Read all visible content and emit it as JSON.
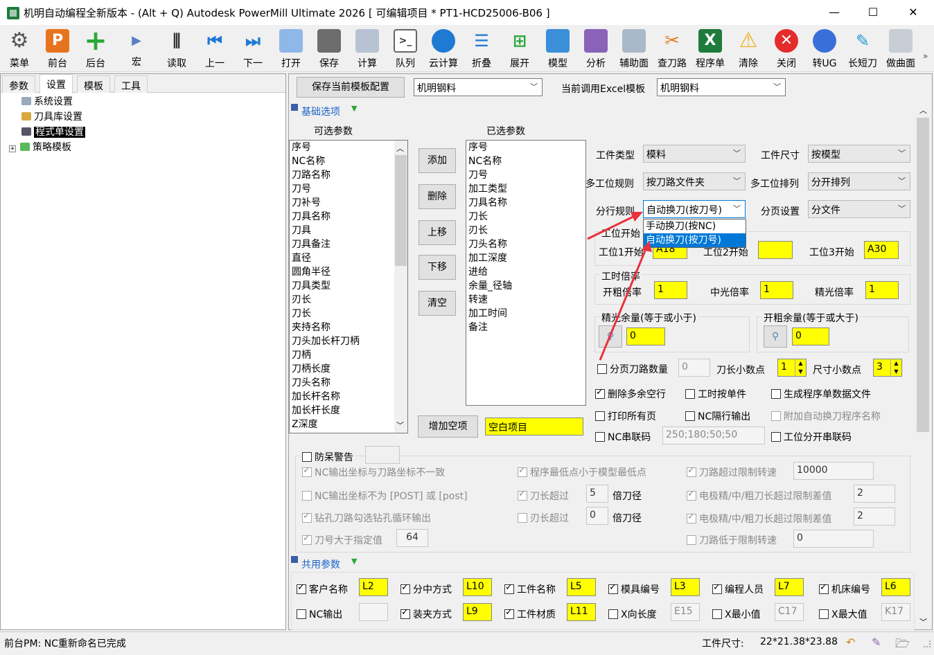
{
  "window": {
    "title": "机明自动编程全新版本 - (Alt + Q) Autodesk PowerMill Ultimate 2026    [ 可编辑项目 * PT1-HCD25006-B06 ]",
    "min": "—",
    "max": "☐",
    "close": "✕"
  },
  "toolbar": {
    "items": [
      {
        "label": "菜单",
        "icon": "gear-icon"
      },
      {
        "label": "前台",
        "icon": "powermill-icon"
      },
      {
        "label": "后台",
        "icon": "plus-icon"
      },
      {
        "label": "宏",
        "icon": "macro-icon"
      },
      {
        "label": "读取",
        "icon": "sliders-icon"
      },
      {
        "label": "上一",
        "icon": "prev-icon"
      },
      {
        "label": "下一",
        "icon": "next-icon"
      },
      {
        "label": "打开",
        "icon": "folder-icon"
      },
      {
        "label": "保存",
        "icon": "save-icon"
      },
      {
        "label": "计算",
        "icon": "calculator-icon"
      },
      {
        "label": "队列",
        "icon": "terminal-icon"
      },
      {
        "label": "云计算",
        "icon": "cloud-icon"
      },
      {
        "label": "折叠",
        "icon": "collapse-icon"
      },
      {
        "label": "展开",
        "icon": "expand-icon"
      },
      {
        "label": "模型",
        "icon": "cube-icon"
      },
      {
        "label": "分析",
        "icon": "analyze-icon"
      },
      {
        "label": "辅助面",
        "icon": "surface-icon"
      },
      {
        "label": "查刀路",
        "icon": "tools-icon"
      },
      {
        "label": "程序单",
        "icon": "excel-icon"
      },
      {
        "label": "清除",
        "icon": "warning-icon"
      },
      {
        "label": "关闭",
        "icon": "close-circle-icon"
      },
      {
        "label": "转UG",
        "icon": "ug-icon"
      },
      {
        "label": "长短刀",
        "icon": "tool-length-icon"
      },
      {
        "label": "做曲面",
        "icon": "make-surface-icon"
      }
    ],
    "overflow": "»"
  },
  "left": {
    "tabs": [
      "参数",
      "设置",
      "模板",
      "工具"
    ],
    "tree": [
      {
        "label": "系统设置"
      },
      {
        "label": "刀具库设置"
      },
      {
        "label": "程式单设置"
      },
      {
        "label": "策略模板"
      }
    ]
  },
  "top": {
    "save_button": "保存当前模板配置",
    "template_value": "机明钢料",
    "excel_label": "当前调用Excel模板",
    "excel_value": "机明钢料"
  },
  "basic": {
    "section_title": "基础选项",
    "available_title": "可选参数",
    "selected_title": "已选参数",
    "available": [
      "序号",
      "NC名称",
      "刀路名称",
      "刀号",
      "刀补号",
      "刀具名称",
      "刀具",
      "刀具备注",
      "直径",
      "圆角半径",
      "刀具类型",
      "刃长",
      "刀长",
      "夹持名称",
      "刀头加长杆刀柄",
      "刀柄",
      "刀柄长度",
      "刀头名称",
      "加长杆名称",
      "加长杆长度",
      "Z深度"
    ],
    "selected": [
      "序号",
      "NC名称",
      "刀号",
      "加工类型",
      "刀具名称",
      "刀长",
      "刃长",
      "刀头名称",
      "加工深度",
      "进给",
      "余量_径轴",
      "转速",
      "加工时间",
      "备注"
    ],
    "buttons": {
      "add": "添加",
      "delete": "删除",
      "up": "上移",
      "down": "下移",
      "clear": "清空"
    },
    "add_blank": "增加空项",
    "blank_value": "空白项目"
  },
  "settings": {
    "workpiece_type_label": "工件类型",
    "workpiece_type": "模料",
    "workpiece_size_label": "工件尺寸",
    "workpiece_size": "按模型",
    "multi_rule_label": "多工位规则",
    "multi_rule": "按刀路文件夹",
    "multi_order_label": "多工位排列",
    "multi_order": "分开排列",
    "line_rule_label": "分行规则",
    "line_rule": "自动换刀(按刀号)",
    "page_label": "分页设置",
    "page_value": "分文件",
    "dropdown_options": [
      "手动换刀(按NC)",
      "自动换刀(按刀号)"
    ],
    "station_start_title": "工位开始",
    "station1_label": "工位1开始",
    "station1": "A18",
    "station2_label": "工位2开始",
    "station2": "",
    "station3_label": "工位3开始",
    "station3": "A30",
    "rate_title": "工时倍率",
    "rough_rate_label": "开粗倍率",
    "rough_rate": "1",
    "semi_rate_label": "中光倍率",
    "semi_rate": "1",
    "finish_rate_label": "精光倍率",
    "finish_rate": "1",
    "finish_allow_title": "精光余量(等于或小于)",
    "finish_allow": "0",
    "rough_allow_title": "开粗余量(等于或大于)",
    "rough_allow": "0",
    "page_count_label": "分页刀路数量",
    "page_count": "0",
    "tool_decimal_label": "刀长小数点",
    "tool_decimal": "1",
    "size_decimal_label": "尺寸小数点",
    "size_decimal": "3",
    "del_blank": "删除多余空行",
    "time_single": "工时按单件",
    "gen_data": "生成程序单数据文件",
    "print_all": "打印所有页",
    "nc_alt": "NC隔行输出",
    "attach_auto": "附加自动换刀程序名称",
    "nc_serial_label": "NC串联码",
    "nc_serial": "250;180;50;50",
    "station_serial": "工位分开串联码"
  },
  "warnings": {
    "title": "防呆警告",
    "w1": "NC输出坐标与刀路坐标不一致",
    "w2": "程序最低点小于模型最低点",
    "w3": "刀路超过限制转速",
    "w3_value": "10000",
    "w4": "NC输出坐标不为 [POST] 或 [post]",
    "w5": "刀长超过",
    "w5_value": "5",
    "w5_unit": "倍刀径",
    "w6": "电极精/中/粗刀长超过限制差值",
    "w6_value": "2",
    "w7": "钻孔刀路勾选钻孔循环输出",
    "w8": "刃长超过",
    "w8_value": "0",
    "w8_unit": "倍刀径",
    "w9": "电极精/中/粗刀长超过限制差值",
    "w9_value": "2",
    "w10": "刀号大于指定值",
    "w10_value": "64",
    "w11": "刀路低于限制转速",
    "w11_value": "0"
  },
  "shared": {
    "section_title": "共用参数",
    "row1": [
      {
        "label": "客户名称",
        "value": "L2"
      },
      {
        "label": "分中方式",
        "value": "L10"
      },
      {
        "label": "工件名称",
        "value": "L5"
      },
      {
        "label": "模具编号",
        "value": "L3"
      },
      {
        "label": "编程人员",
        "value": "L7"
      },
      {
        "label": "机床编号",
        "value": "L6"
      }
    ],
    "row2": [
      {
        "label": "NC输出",
        "value": ""
      },
      {
        "label": "装夹方式",
        "value": "L9"
      },
      {
        "label": "工件材质",
        "value": "L11"
      },
      {
        "label": "X向长度",
        "value": "E15"
      },
      {
        "label": "X最小值",
        "value": "C17"
      },
      {
        "label": "X最大值",
        "value": "K17"
      }
    ]
  },
  "status": {
    "message": "前台PM: NC重新命名已完成",
    "size_label": "工件尺寸:",
    "size_value": "22*21.38*23.88"
  },
  "colors": {
    "highlight": "#ffff00",
    "selection": "#0078d7",
    "arrow": "#e8323c",
    "section": "#1a64c8"
  }
}
